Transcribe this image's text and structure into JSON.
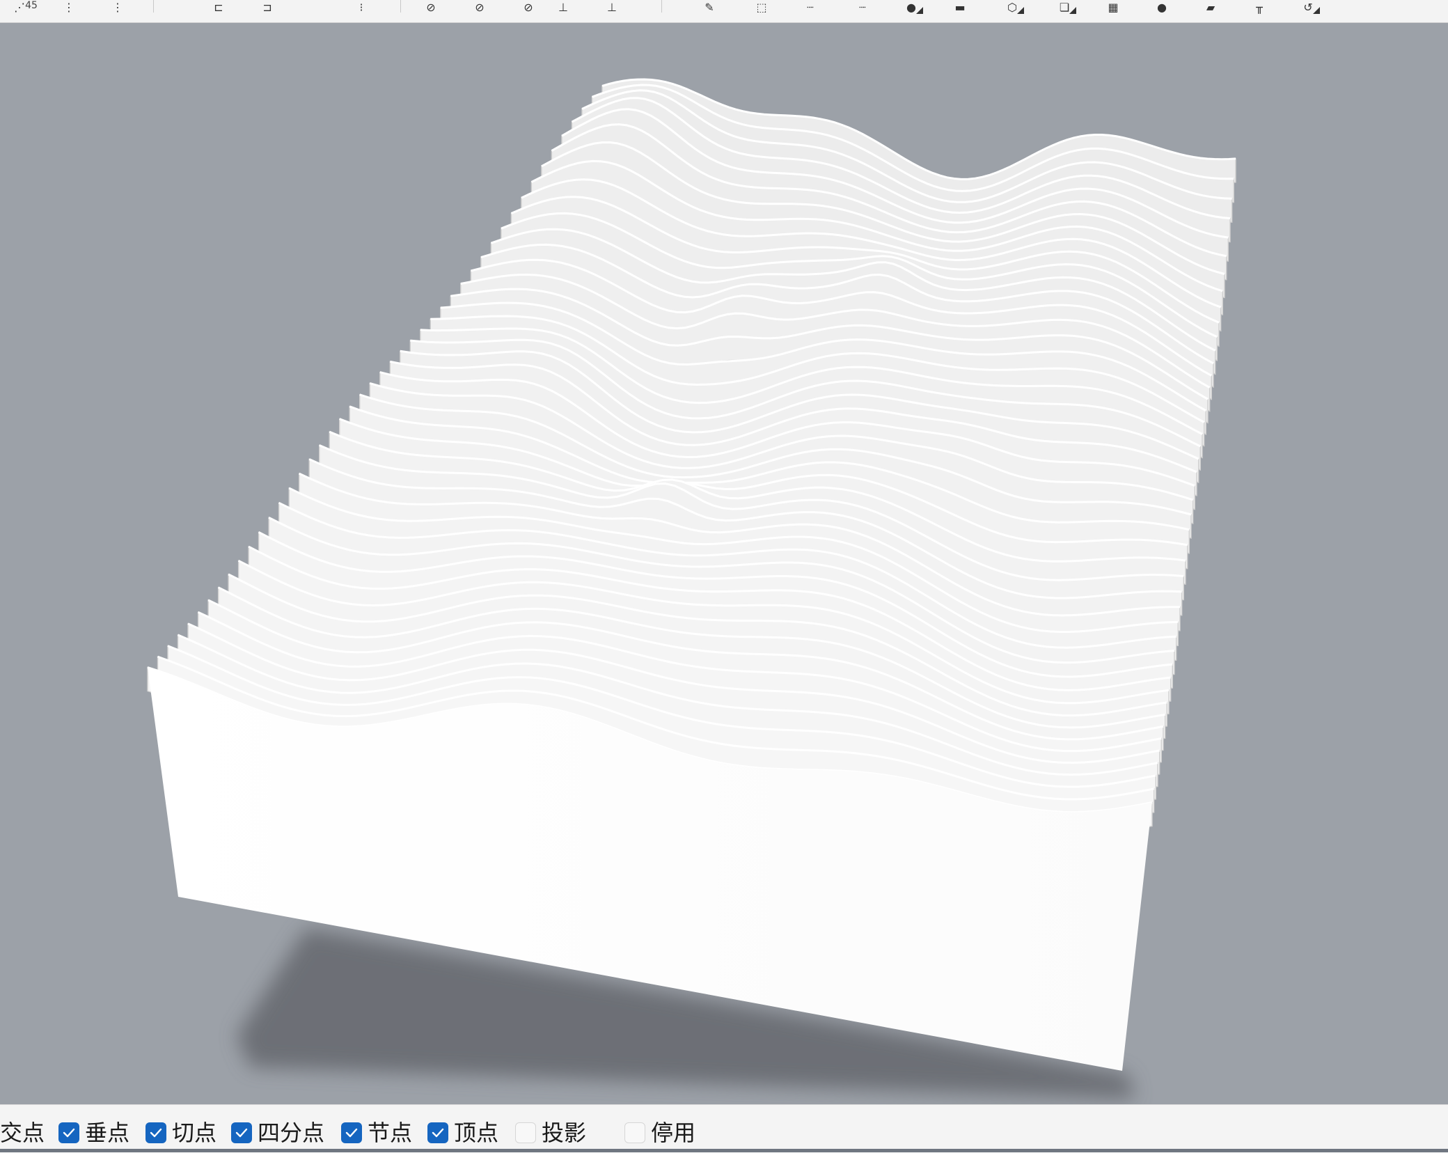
{
  "toolbar": {
    "buttons": [
      {
        "name": "snap-angle-button",
        "label": "45",
        "glyph": "⋰"
      },
      {
        "name": "snap-point-button-1",
        "label": "",
        "glyph": "⋮"
      },
      {
        "name": "snap-point-button-2",
        "label": "",
        "glyph": "⋮"
      },
      {
        "name": "align-left-button",
        "label": "",
        "glyph": "⊏"
      },
      {
        "name": "align-point-button",
        "label": "",
        "glyph": "⊐"
      },
      {
        "name": "snap-grid-button",
        "label": "",
        "glyph": "⁝"
      },
      {
        "name": "hatch-button",
        "label": "",
        "glyph": "⊘"
      },
      {
        "name": "hatch-color-button",
        "label": "",
        "glyph": "⊘"
      },
      {
        "name": "hatch-pattern-button",
        "label": "",
        "glyph": "⊘"
      },
      {
        "name": "dimension-button-1",
        "label": "",
        "glyph": "⊥"
      },
      {
        "name": "dimension-button-2",
        "label": "",
        "glyph": "⊥"
      },
      {
        "name": "pencil-button",
        "label": "",
        "glyph": "✎"
      },
      {
        "name": "box-button",
        "label": "",
        "glyph": "⬚"
      },
      {
        "name": "dotted-line-button-1",
        "label": "",
        "glyph": "┈"
      },
      {
        "name": "dotted-line-button-2",
        "label": "",
        "glyph": "┈"
      },
      {
        "name": "sphere-button",
        "label": "",
        "glyph": "●"
      },
      {
        "name": "slab-button",
        "label": "",
        "glyph": "▬"
      },
      {
        "name": "cube-button",
        "label": "",
        "glyph": "⬡"
      },
      {
        "name": "layer-stack-button",
        "label": "",
        "glyph": "❏"
      },
      {
        "name": "mesh-button",
        "label": "",
        "glyph": "▦"
      },
      {
        "name": "render-sphere-button",
        "label": "",
        "glyph": "●"
      },
      {
        "name": "folder-button",
        "label": "",
        "glyph": "▰"
      },
      {
        "name": "pipe-button",
        "label": "",
        "glyph": "╥"
      },
      {
        "name": "rotate-view-button",
        "label": "",
        "glyph": "↺"
      }
    ]
  },
  "osnap": {
    "items": [
      {
        "name": "osnap-intersection",
        "label": "交点",
        "checked": null
      },
      {
        "name": "osnap-perpendicular",
        "label": "垂点",
        "checked": true
      },
      {
        "name": "osnap-tangent",
        "label": "切点",
        "checked": true
      },
      {
        "name": "osnap-quadrant",
        "label": "四分点",
        "checked": true
      },
      {
        "name": "osnap-knot",
        "label": "节点",
        "checked": true
      },
      {
        "name": "osnap-vertex",
        "label": "顶点",
        "checked": true
      },
      {
        "name": "osnap-project",
        "label": "投影",
        "checked": false
      },
      {
        "name": "osnap-disable",
        "label": "停用",
        "checked": false
      }
    ]
  },
  "colors": {
    "viewport_background": "#9ca1a8",
    "checkbox_checked": "#1565c0",
    "model": "#ffffff",
    "shadow": "#6b6f75"
  }
}
